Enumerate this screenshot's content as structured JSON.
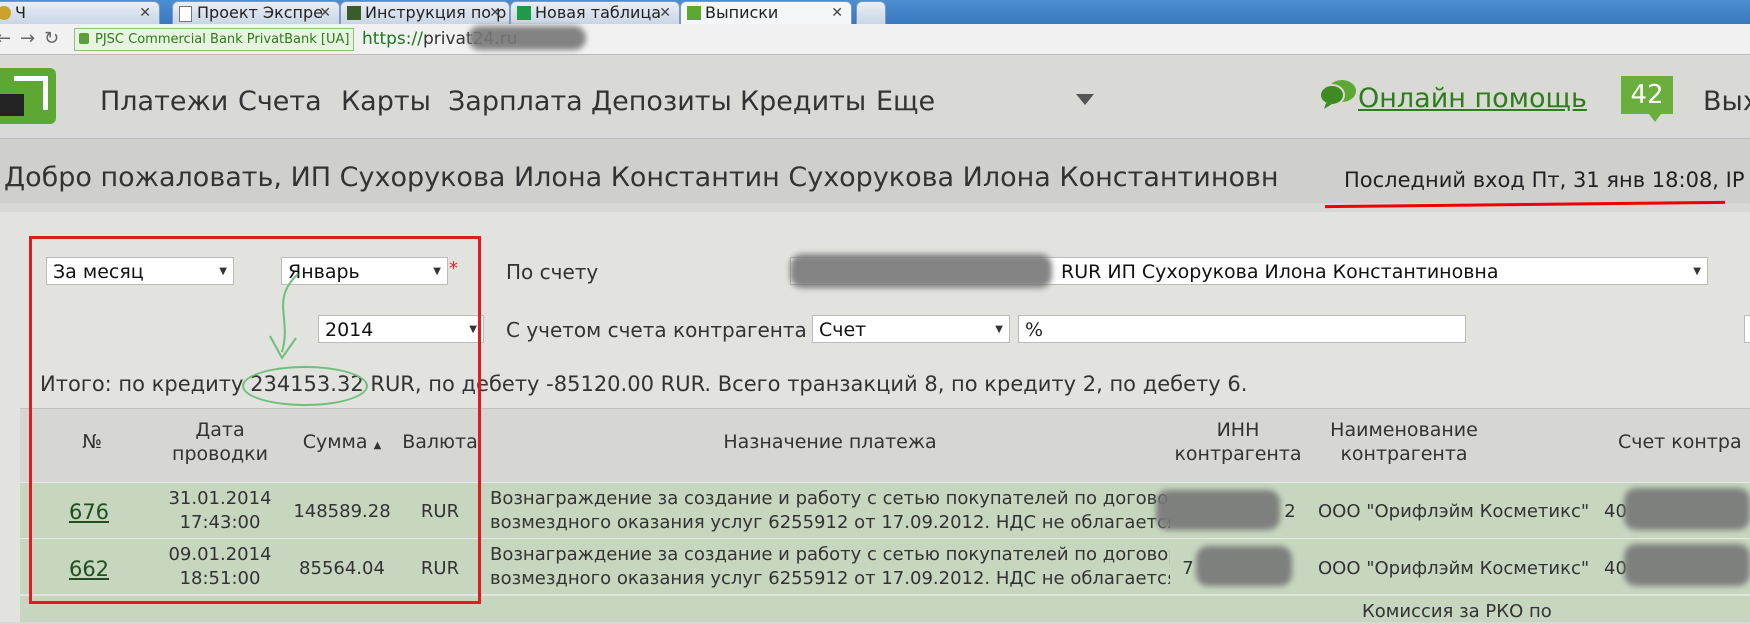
{
  "browser": {
    "tabs": [
      {
        "label": "Ч"
      },
      {
        "label": "Проект Экспре"
      },
      {
        "label": "Инструкция по р"
      },
      {
        "label": "Новая таблица"
      },
      {
        "label": "Выписки"
      }
    ],
    "ev_label": "PJSC Commercial Bank PrivatBank [UA]",
    "url_scheme": "https://",
    "url_host": "privat24.ru"
  },
  "nav": {
    "items": [
      "Платежи",
      "Счета",
      "Карты",
      "Зарплата",
      "Депозиты",
      "Кредиты",
      "Еще"
    ],
    "help": "Онлайн помощь",
    "badge": "42",
    "exit": "Вых"
  },
  "welcome": {
    "title": "Добро пожаловать, ИП Сухорукова Илона Константин Сухорукова Илона Константиновн",
    "last_login": "Последний вход Пт, 31 янв 18:08, IP"
  },
  "filters": {
    "period": "За месяц",
    "month": "Январь",
    "year": "2014",
    "account_label": "По счету",
    "account_value": "RUR ИП Сухорукова Илона Константиновна",
    "counterparty_label": "С учетом счета контрагента",
    "counterparty_type": "Счет",
    "counterparty_value": "%",
    "required_mark": "*"
  },
  "summary": "Итого: по кредиту 234153.32 RUR, по дебету -85120.00 RUR. Всего транзакций 8, по кредиту 2, по дебету 6.",
  "table": {
    "headers": {
      "num": "№",
      "date_1": "Дата",
      "date_2": "проводки",
      "amount": "Сумма",
      "sort_icon": "▲",
      "currency": "Валюта",
      "purpose": "Назначение платежа",
      "inn_1": "ИНН",
      "inn_2": "контрагента",
      "name_1": "Наименование",
      "name_2": "контрагента",
      "account": "Счет контра"
    },
    "rows": [
      {
        "num": "676",
        "date": "31.01.2014",
        "time": "17:43:00",
        "amount": "148589.28",
        "currency": "RUR",
        "purpose_1": "Вознаграждение за создание и работу с сетью покупателей по договору",
        "purpose_2": "возмездного оказания услуг 6255912 от 17.09.2012. НДС не облагается.",
        "inn": "2",
        "name": "ООО \"Орифлэйм Косметикс\"",
        "account": "40"
      },
      {
        "num": "662",
        "date": "09.01.2014",
        "time": "18:51:00",
        "amount": "85564.04",
        "currency": "RUR",
        "purpose_1": "Вознаграждение за создание и работу с сетью покупателей по договору",
        "purpose_2": "возмездного оказания услуг 6255912 от 17.09.2012. НДС не облагается.",
        "inn": "7",
        "name": "ООО \"Орифлэйм Косметикс\"",
        "account": "40"
      }
    ],
    "partial_row_text": "Комиссия за РКО по"
  }
}
